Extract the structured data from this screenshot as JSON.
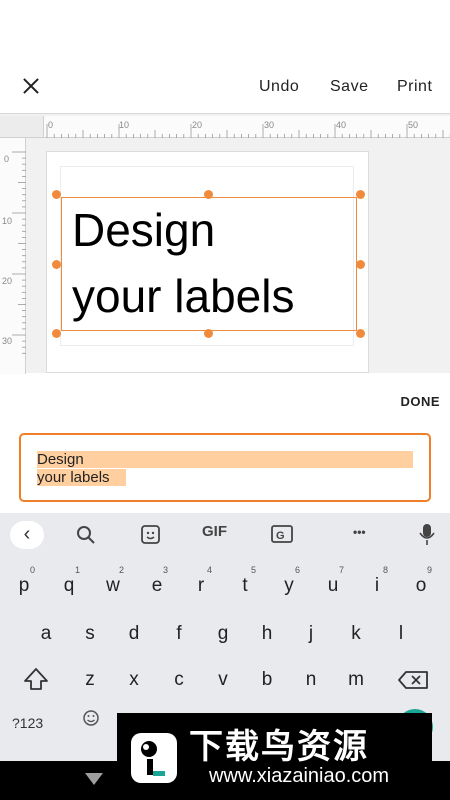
{
  "topbar": {
    "close_icon": "close-icon",
    "undo_label": "Undo",
    "save_label": "Save",
    "print_label": "Print"
  },
  "ruler": {
    "horizontal_ticks": [
      "0",
      "10",
      "20",
      "30",
      "40",
      "50"
    ],
    "vertical_ticks": [
      "0",
      "10",
      "20",
      "30"
    ]
  },
  "canvas": {
    "line1": "Design",
    "line2": "your labels",
    "selection_color": "#f08a3c"
  },
  "done_label": "DONE",
  "text_input": {
    "line1": "Design",
    "line2": "your labels",
    "highlight_color": "#ffcf9f",
    "border_color": "#ef7f2a"
  },
  "keyboard": {
    "toolbar": {
      "back_icon": "chevron-left-icon",
      "search_icon": "search-icon",
      "sticker_icon": "sticker-icon",
      "gif_label": "GIF",
      "translate_icon": "translate-icon",
      "more_label": "•••",
      "mic_icon": "microphone-icon"
    },
    "row1": [
      {
        "key": "q",
        "hint": "1"
      },
      {
        "key": "w",
        "hint": "2"
      },
      {
        "key": "e",
        "hint": "3"
      },
      {
        "key": "r",
        "hint": "4"
      },
      {
        "key": "t",
        "hint": "5"
      },
      {
        "key": "y",
        "hint": "6"
      },
      {
        "key": "u",
        "hint": "7"
      },
      {
        "key": "i",
        "hint": "8"
      },
      {
        "key": "o",
        "hint": "9"
      },
      {
        "key": "p",
        "hint": "0"
      }
    ],
    "row2": [
      "a",
      "s",
      "d",
      "f",
      "g",
      "h",
      "j",
      "k",
      "l"
    ],
    "row3": [
      "z",
      "x",
      "c",
      "v",
      "b",
      "n",
      "m"
    ],
    "symbols_label": "?123",
    "shift_icon": "shift-icon",
    "backspace_icon": "backspace-icon",
    "emoji_icon": "emoji-icon",
    "accent_color": "#1aa595"
  },
  "watermark": {
    "title": "下载鸟资源",
    "url": "www.xiazainiao.com"
  }
}
